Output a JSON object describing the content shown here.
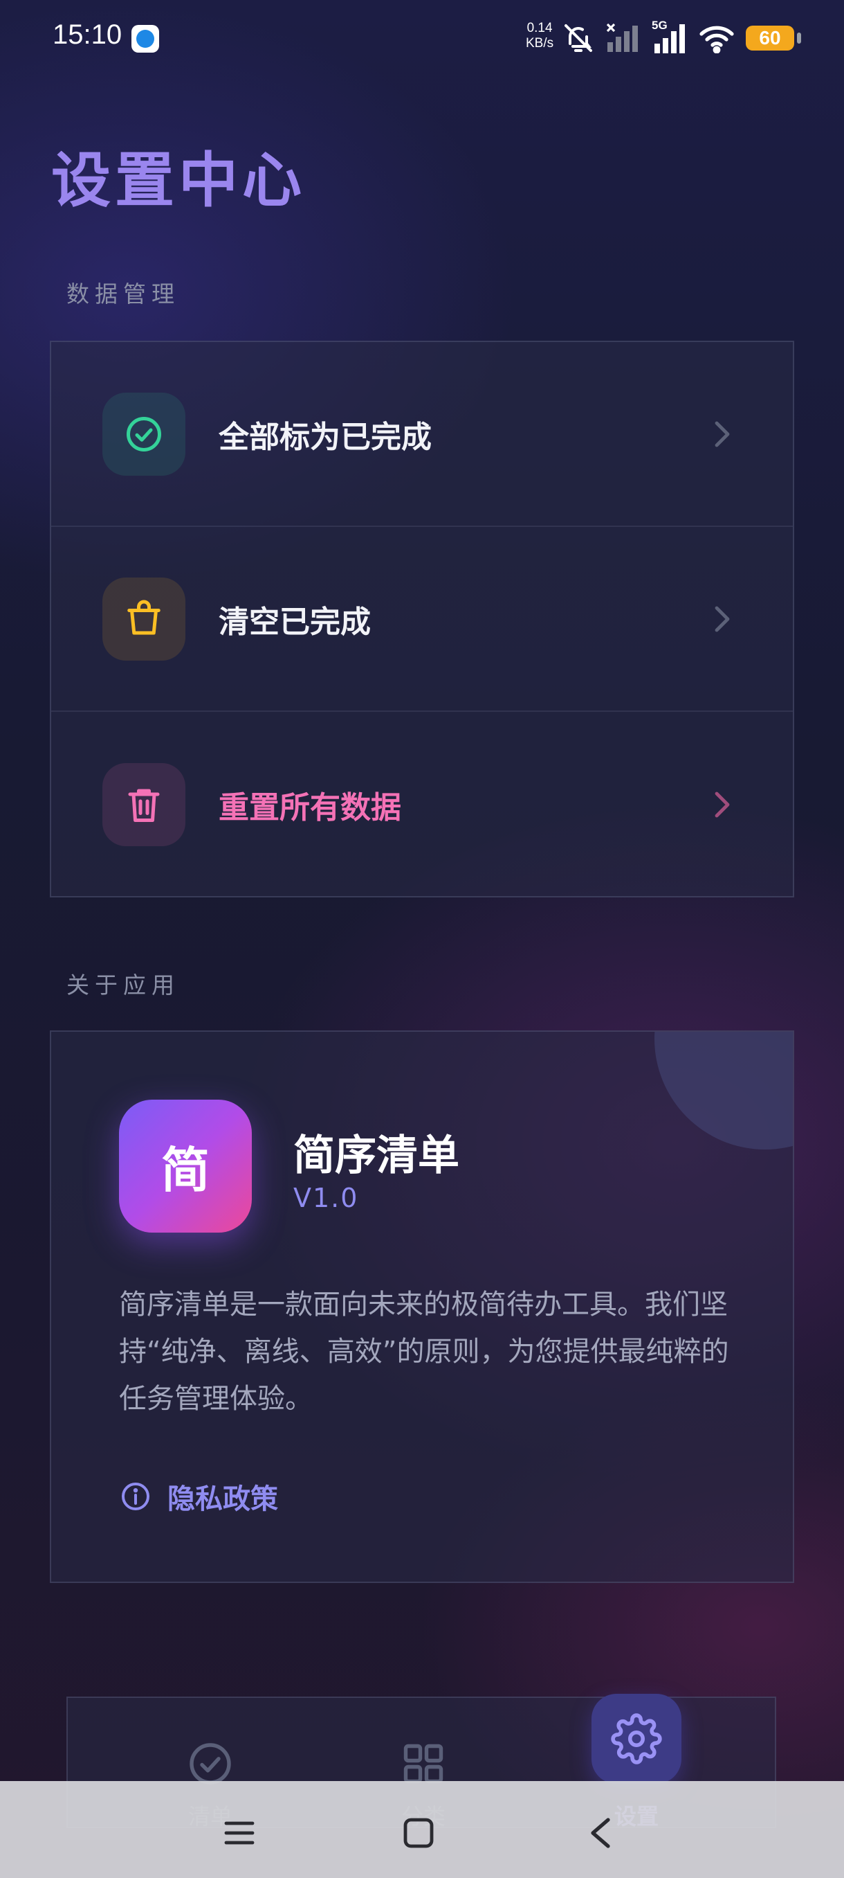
{
  "status_bar": {
    "time": "15:10",
    "net_speed_value": "0.14",
    "net_speed_unit": "KB/s",
    "network_type": "5G",
    "battery": "60"
  },
  "page": {
    "title": "设置中心"
  },
  "data_section": {
    "label": "数据管理",
    "items": [
      {
        "label": "全部标为已完成",
        "icon": "check-circle-icon",
        "color": "#34d399"
      },
      {
        "label": "清空已完成",
        "icon": "bag-icon",
        "color": "#fbbf24"
      },
      {
        "label": "重置所有数据",
        "icon": "trash-icon",
        "color": "#f472b6"
      }
    ]
  },
  "about_section": {
    "label": "关于应用",
    "logo_char": "简",
    "app_name": "简序清单",
    "version": "V1.0",
    "description": "简序清单是一款面向未来的极简待办工具。我们坚持“纯净、离线、高效”的原则，为您提供最纯粹的任务管理体验。",
    "privacy_label": "隐私政策"
  },
  "tab_bar": {
    "tabs": [
      {
        "label": "清单",
        "icon": "check-circle-icon",
        "active": false
      },
      {
        "label": "分类",
        "icon": "grid-icon",
        "active": false
      },
      {
        "label": "设置",
        "icon": "gear-icon",
        "active": true
      }
    ]
  },
  "colors": {
    "accent": "#8f8cf0",
    "title": "#9a86ee",
    "success": "#34d399",
    "warning": "#fbbf24",
    "danger": "#f472b6"
  }
}
